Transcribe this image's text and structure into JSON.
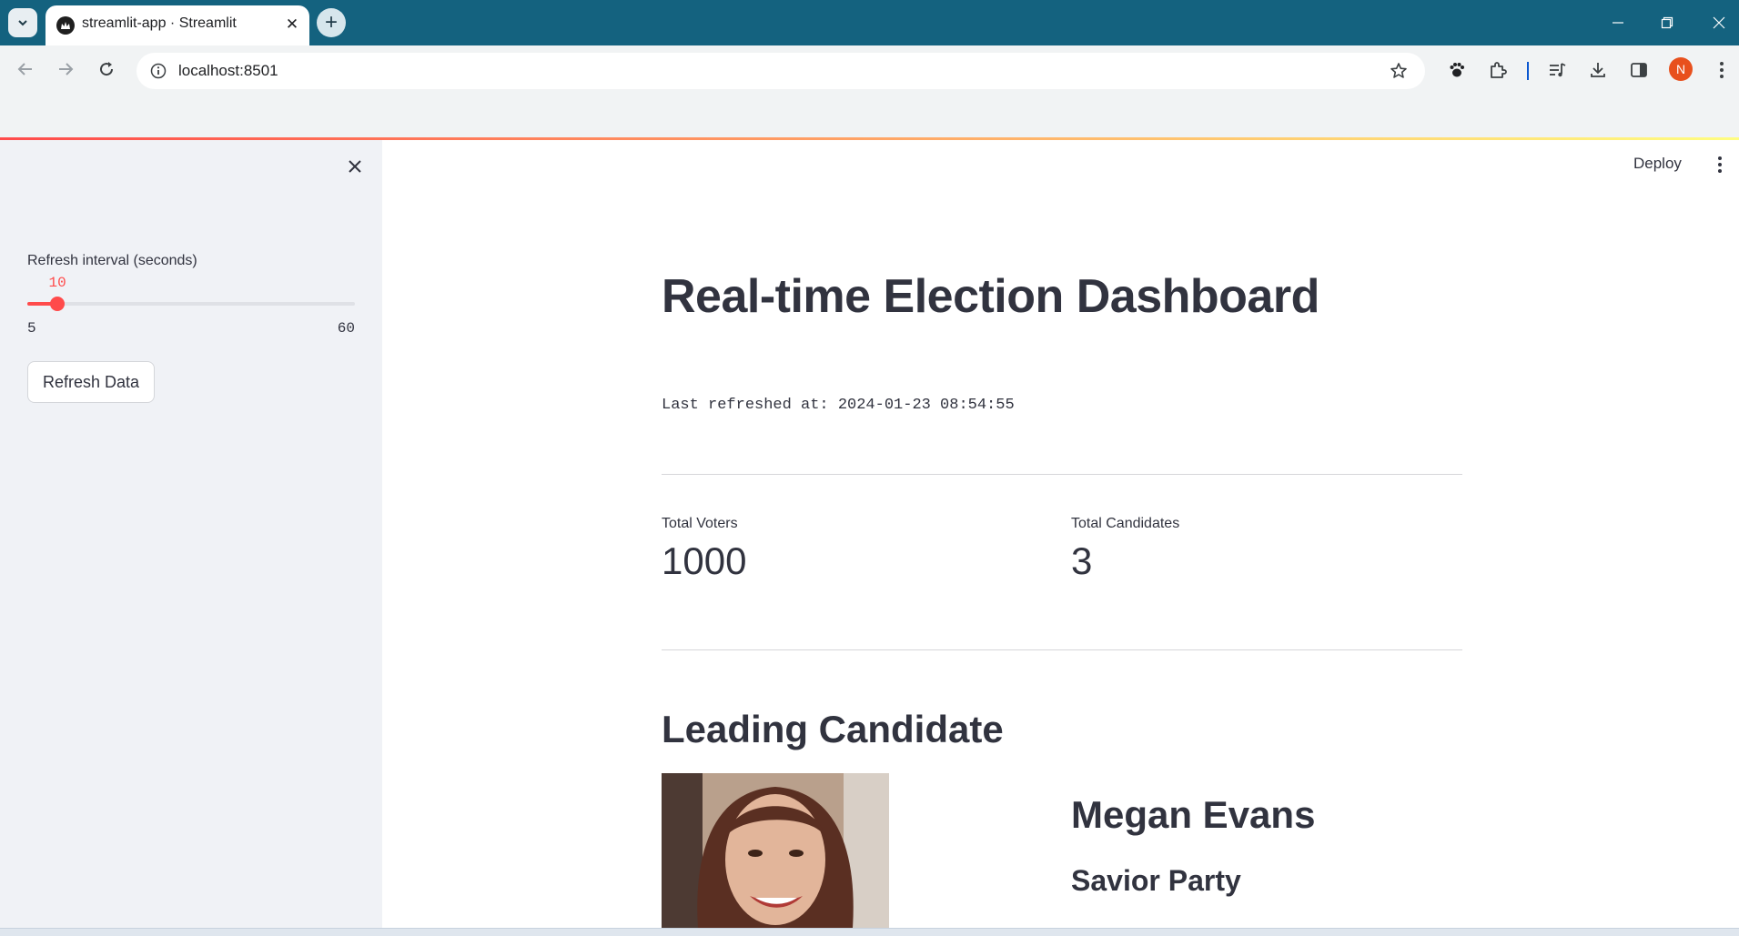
{
  "browser": {
    "tab_title": "streamlit-app · Streamlit",
    "url": "localhost:8501",
    "profile_initial": "N",
    "accent_color": "#14627f"
  },
  "sidebar": {
    "slider": {
      "label": "Refresh interval (seconds)",
      "value": "10",
      "min": "5",
      "max": "60",
      "numeric_value": 10,
      "numeric_min": 5,
      "numeric_max": 60
    },
    "refresh_button": "Refresh Data"
  },
  "header": {
    "deploy_label": "Deploy"
  },
  "main": {
    "title": "Real-time Election Dashboard",
    "last_refreshed": "Last refreshed at: 2024-01-23 08:54:55",
    "metrics": [
      {
        "label": "Total Voters",
        "value": "1000"
      },
      {
        "label": "Total Candidates",
        "value": "3"
      }
    ],
    "leading_heading": "Leading Candidate",
    "candidate": {
      "name": "Megan Evans",
      "party": "Savior Party"
    }
  },
  "colors": {
    "primary": "#ff4b4b",
    "text": "#31333f",
    "sidebar_bg": "#f0f2f6"
  }
}
